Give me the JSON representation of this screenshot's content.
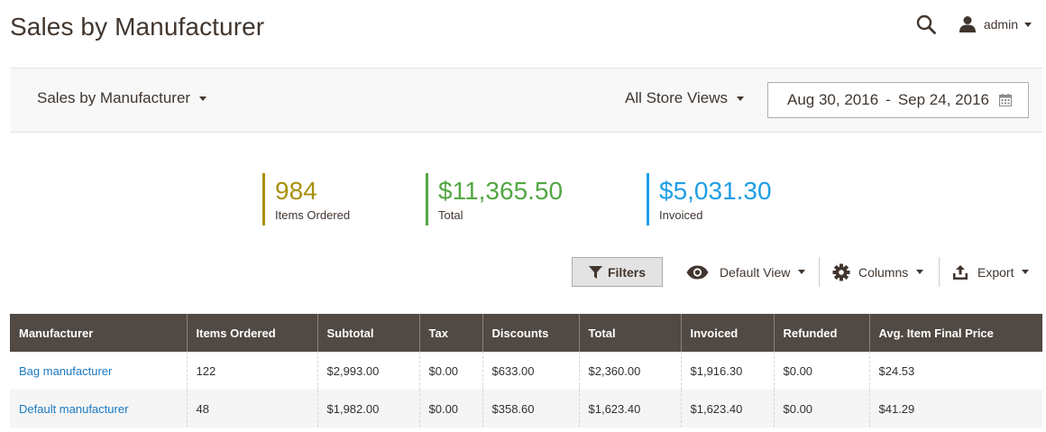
{
  "header": {
    "title": "Sales by Manufacturer",
    "user": "admin"
  },
  "toolbar": {
    "report": "Sales by Manufacturer",
    "store_view": "All Store Views",
    "date_from": "Aug 30, 2016",
    "date_sep": "-",
    "date_to": "Sep 24, 2016"
  },
  "stats": {
    "items_ordered": {
      "value": "984",
      "label": "Items Ordered",
      "color": "#a8900b"
    },
    "total": {
      "value": "$11,365.50",
      "label": "Total",
      "color": "#53a744"
    },
    "invoiced": {
      "value": "$5,031.30",
      "label": "Invoiced",
      "color": "#1f9ee5"
    }
  },
  "grid_controls": {
    "filters": "Filters",
    "view": "Default View",
    "columns": "Columns",
    "export": "Export"
  },
  "table": {
    "columns": [
      "Manufacturer",
      "Items Ordered",
      "Subtotal",
      "Tax",
      "Discounts",
      "Total",
      "Invoiced",
      "Refunded",
      "Avg. Item Final Price"
    ],
    "rows": [
      [
        "Bag manufacturer",
        "122",
        "$2,993.00",
        "$0.00",
        "$633.00",
        "$2,360.00",
        "$1,916.30",
        "$0.00",
        "$24.53"
      ],
      [
        "Default manufacturer",
        "48",
        "$1,982.00",
        "$0.00",
        "$358.60",
        "$1,623.40",
        "$1,623.40",
        "$0.00",
        "$41.29"
      ]
    ]
  },
  "colors": {
    "header_bg": "#514943",
    "link": "#1979c3"
  }
}
